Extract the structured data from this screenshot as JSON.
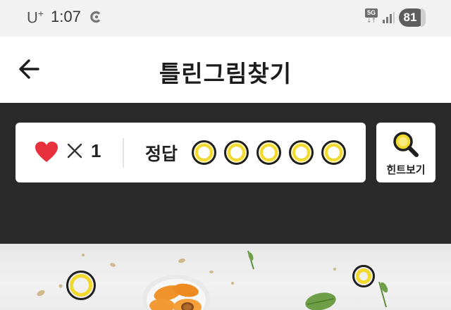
{
  "status_bar": {
    "carrier": "U",
    "carrier_sup": "+",
    "time": "1:07",
    "network": "5G",
    "battery": "81"
  },
  "header": {
    "title": "틀린그림찾기",
    "back_icon": "arrow-left-icon"
  },
  "game": {
    "lives_icon": "heart-icon",
    "lives_multiplier": "×",
    "lives_count": "1",
    "answer_label": "정답",
    "answers_total": 5,
    "answers_found": 0,
    "hint_label": "힌트보기",
    "hint_icon": "magnifier-icon"
  },
  "colors": {
    "panel_bg": "#2a2a2a",
    "accent_yellow": "#f2d92e",
    "heart_red": "#e8313d"
  }
}
